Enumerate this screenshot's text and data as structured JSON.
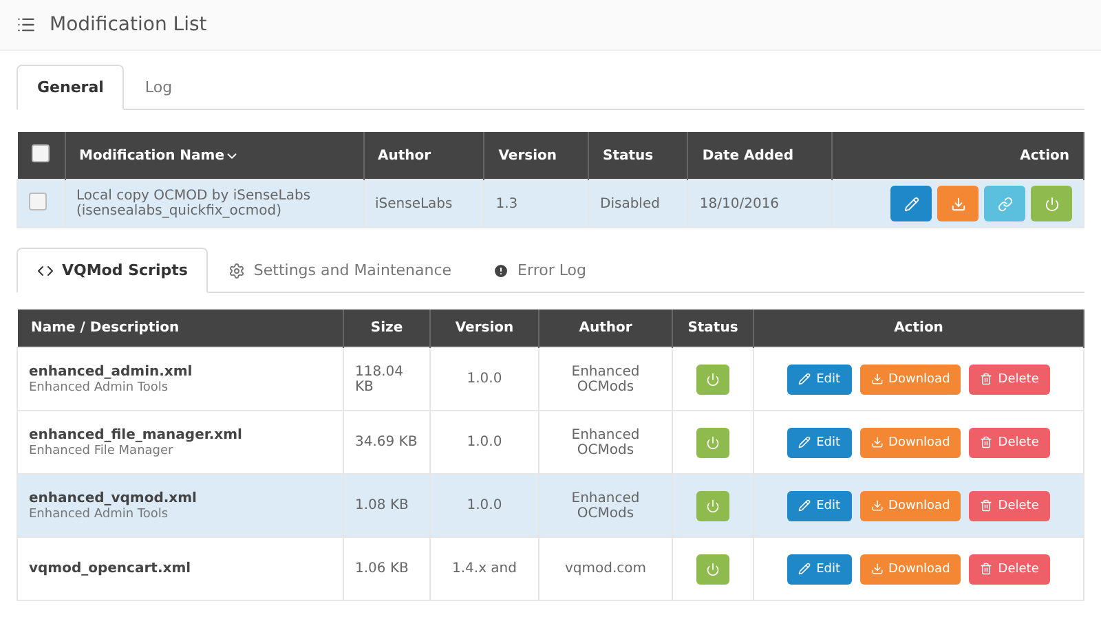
{
  "header": {
    "title": "Modification List"
  },
  "tabs": [
    {
      "label": "General",
      "selected": true
    },
    {
      "label": "Log",
      "selected": false
    }
  ],
  "modifications": {
    "select_all": {
      "checked": false
    },
    "columns": [
      "Modification Name",
      "Author",
      "Version",
      "Status",
      "Date Added",
      "Action"
    ],
    "rows": [
      {
        "name": "Local copy OCMOD by iSenseLabs",
        "code": "(isensealabs_quickfix_ocmod)",
        "author": "iSenseLabs",
        "version": "1.3",
        "status": "Disabled",
        "date_added": "18/10/2016",
        "checked": false,
        "selected": true
      }
    ]
  },
  "vqmod_tabs": [
    {
      "label": "VQMod Scripts",
      "selected": true
    },
    {
      "label": "Settings and Maintenance",
      "selected": false
    },
    {
      "label": "Error Log",
      "selected": false
    }
  ],
  "scripts": {
    "columns": [
      "Name / Description",
      "Size",
      "Version",
      "Author",
      "Status",
      "Action"
    ],
    "rows": [
      {
        "name": "enhanced_admin.xml",
        "description": "Enhanced Admin Tools",
        "size": "118.04 KB",
        "version": "1.0.0",
        "author": "Enhanced OCMods",
        "edit": "Edit",
        "download": "Download",
        "delete": "Delete",
        "selected": false
      },
      {
        "name": "enhanced_file_manager.xml",
        "description": "Enhanced File Manager",
        "size": "34.69 KB",
        "version": "1.0.0",
        "author": "Enhanced OCMods",
        "edit": "Edit",
        "download": "Download",
        "delete": "Delete",
        "selected": false
      },
      {
        "name": "enhanced_vqmod.xml",
        "description": "Enhanced Admin Tools",
        "size": "1.08 KB",
        "version": "1.0.0",
        "author": "Enhanced OCMods",
        "edit": "Edit",
        "download": "Download",
        "delete": "Delete",
        "selected": true
      },
      {
        "name": "vqmod_opencart.xml",
        "size": "1.06 KB",
        "version": "1.4.x and",
        "author": "vqmod.com",
        "edit": "Edit",
        "download": "Download",
        "delete": "Delete",
        "selected": false
      }
    ]
  }
}
